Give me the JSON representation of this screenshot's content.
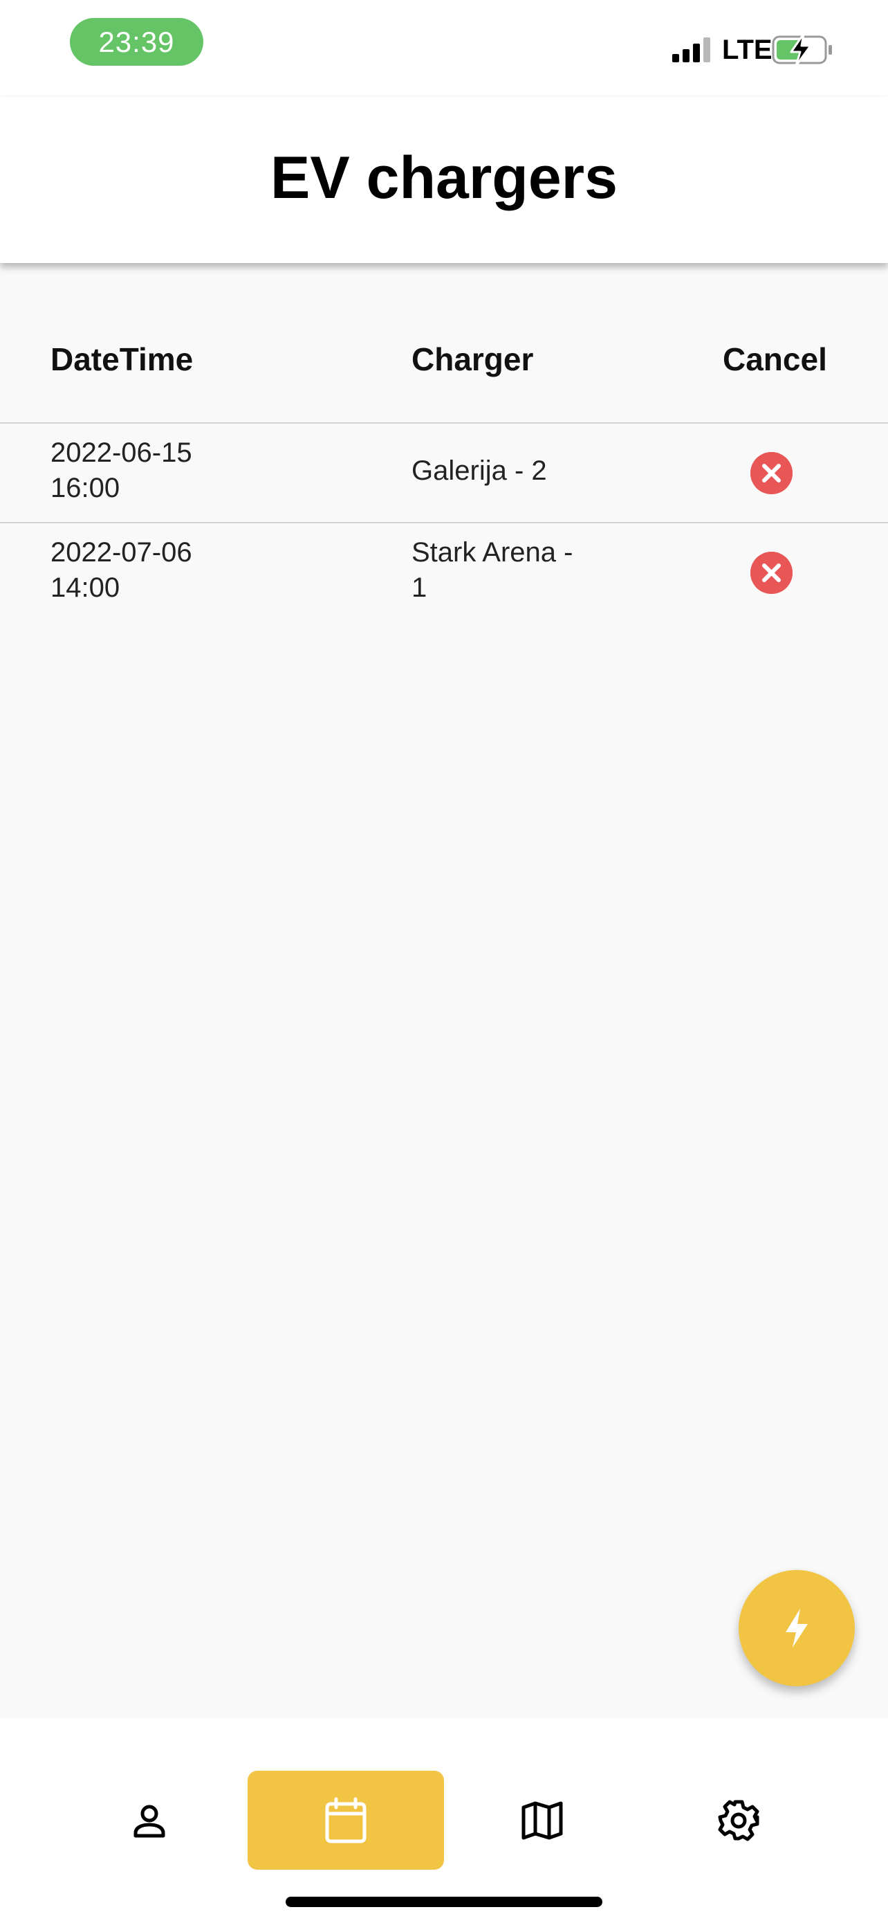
{
  "status_bar": {
    "time": "23:39",
    "network": "LTE",
    "icons": [
      "signal-bars-icon",
      "battery-charging-icon"
    ],
    "time_pill_color": "#65c466"
  },
  "header": {
    "title": "EV chargers"
  },
  "table": {
    "columns": [
      "DateTime",
      "Charger",
      "Cancel"
    ],
    "rows": [
      {
        "datetime": "2022-06-15\n16:00",
        "charger": "Galerija - 2",
        "cancel_icon": "cancel-circle-icon"
      },
      {
        "datetime": "2022-07-06\n14:00",
        "charger": "Stark Arena -\n1",
        "cancel_icon": "cancel-circle-icon"
      }
    ]
  },
  "fab": {
    "icon": "lightning-bolt-icon"
  },
  "bottom_nav": {
    "items": [
      {
        "icon": "person-icon",
        "active": false
      },
      {
        "icon": "calendar-icon",
        "active": true
      },
      {
        "icon": "map-icon",
        "active": false
      },
      {
        "icon": "settings-gear-icon",
        "active": false
      }
    ]
  },
  "colors": {
    "accent": "#f2c444",
    "danger": "#e85656",
    "background": "#f9f9f9",
    "status_green": "#65c466"
  }
}
